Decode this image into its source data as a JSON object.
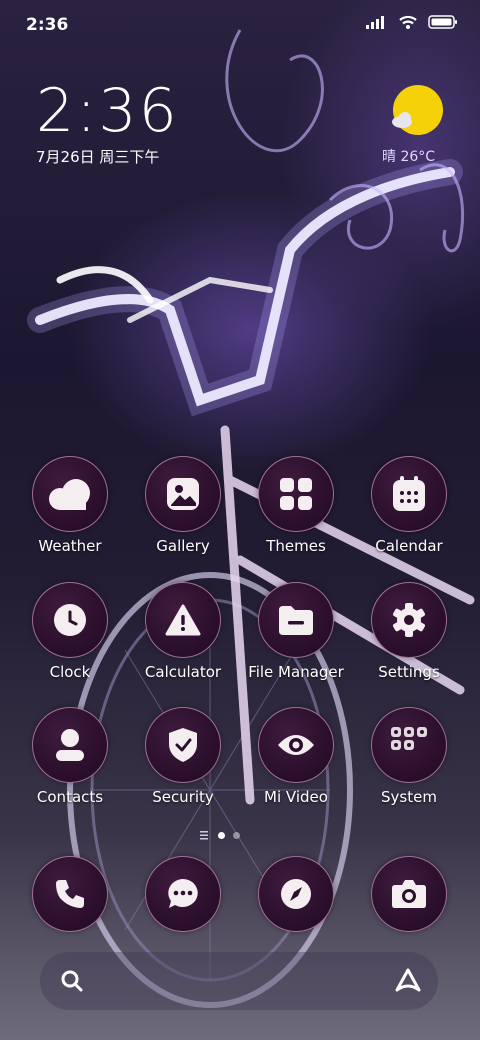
{
  "status_bar": {
    "time": "2:36",
    "icons": [
      "signal-icon",
      "wifi-icon",
      "battery-icon"
    ]
  },
  "clock_widget": {
    "time": "2:36",
    "date": "7月26日 周三下午"
  },
  "weather_widget": {
    "text": "晴 26°C",
    "icon": "sun-cloud-icon",
    "sun_color": "#f5d10a"
  },
  "apps": [
    {
      "label": "Weather",
      "icon": "cloud-icon"
    },
    {
      "label": "Gallery",
      "icon": "image-icon"
    },
    {
      "label": "Themes",
      "icon": "grid-icon"
    },
    {
      "label": "Calendar",
      "icon": "calendar-icon"
    },
    {
      "label": "Clock",
      "icon": "clock-icon"
    },
    {
      "label": "Calculator",
      "icon": "warning-icon"
    },
    {
      "label": "File Manager",
      "icon": "folder-icon"
    },
    {
      "label": "Settings",
      "icon": "gear-icon"
    },
    {
      "label": "Contacts",
      "icon": "person-icon"
    },
    {
      "label": "Security",
      "icon": "shield-icon"
    },
    {
      "label": "Mi Video",
      "icon": "eye-icon"
    },
    {
      "label": "System",
      "icon": "folder-grid-icon"
    }
  ],
  "dock": [
    {
      "name": "phone",
      "icon": "phone-icon"
    },
    {
      "name": "messages",
      "icon": "chat-icon"
    },
    {
      "name": "browser",
      "icon": "compass-icon"
    },
    {
      "name": "camera",
      "icon": "camera-icon"
    }
  ],
  "search_bar": {
    "left_icon": "search-icon",
    "right_icon": "assistant-icon"
  },
  "page_indicator": {
    "pages": 2,
    "current": 1
  },
  "colors": {
    "icon_fill": "#f4eef0",
    "icon_bg": "#2b0f2c",
    "icon_border": "#f2b8e6"
  }
}
